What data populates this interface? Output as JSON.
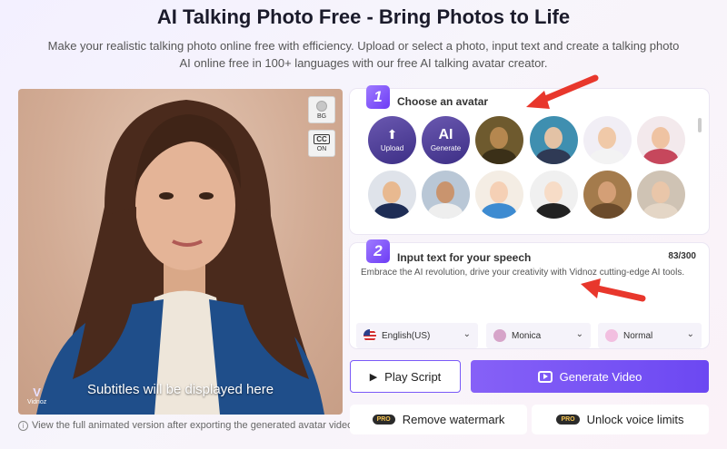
{
  "header": {
    "title": "AI Talking Photo Free - Bring Photos to Life",
    "subtitle_line1": "Make your realistic talking photo online free with efficiency. Upload or select a photo, input text and create a talking photo",
    "subtitle_line2": "AI online free in 100+ languages with our free AI talking avatar creator."
  },
  "preview": {
    "bg_label": "BG",
    "cc_label": "CC",
    "cc_state": "ON",
    "subtitle_overlay": "Subtitles will be displayed here",
    "logo_text": "Vidnoz"
  },
  "footer_note": "View the full animated version after exporting the generated avatar video.",
  "step1": {
    "number": "1",
    "title": "Choose an avatar",
    "upload_label": "Upload",
    "ai_label": "AI",
    "generate_label": "Generate",
    "avatars": [
      {
        "name": "mona-lisa",
        "skin": "#b5874f",
        "cloth": "#3b3018",
        "bg": "#6e5a2e"
      },
      {
        "name": "einstein",
        "skin": "#e3c2a5",
        "cloth": "#2f3a55",
        "bg": "#3f8fb0"
      },
      {
        "name": "cartoon-man",
        "skin": "#f0c9a8",
        "cloth": "#f3f3f3",
        "bg": "#f1eef5"
      },
      {
        "name": "cartoon-woman",
        "skin": "#efc3a2",
        "cloth": "#c6475c",
        "bg": "#f3e9ec"
      },
      {
        "name": "trump",
        "skin": "#e8b990",
        "cloth": "#1e2d55",
        "bg": "#dfe3ea"
      },
      {
        "name": "ronaldo",
        "skin": "#c9946e",
        "cloth": "#eeeeee",
        "bg": "#b9c7d6"
      },
      {
        "name": "red-hair-girl",
        "skin": "#f5d0b5",
        "cloth": "#3d8bd1",
        "bg": "#f4ede4"
      },
      {
        "name": "anime-woman",
        "skin": "#f7dcc7",
        "cloth": "#222222",
        "bg": "#f0f0f0"
      },
      {
        "name": "arab-woman",
        "skin": "#d49f76",
        "cloth": "#6b4b2b",
        "bg": "#a47b4c"
      },
      {
        "name": "hijab-woman",
        "skin": "#e9c6a9",
        "cloth": "#e4d6c6",
        "bg": "#cfc3b4"
      }
    ]
  },
  "step2": {
    "number": "2",
    "title": "Input text for your speech",
    "char_count": "83/300",
    "text": "Embrace the AI revolution, drive your creativity with Vidnoz cutting-edge AI tools."
  },
  "dropdowns": {
    "language": "English(US)",
    "voice": "Monica",
    "speed": "Normal"
  },
  "buttons": {
    "play": "Play Script",
    "generate": "Generate Video",
    "remove_watermark": "Remove watermark",
    "unlock_voice": "Unlock voice limits",
    "pro_badge": "PRO"
  },
  "colors": {
    "accent": "#7a5af8",
    "arrow": "#e8372c"
  }
}
